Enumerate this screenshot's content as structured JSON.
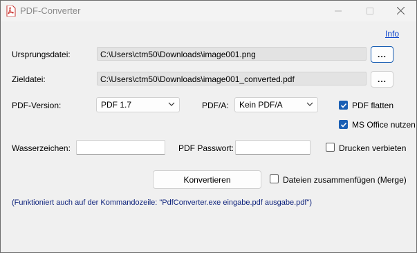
{
  "window": {
    "title": "PDF-Converter"
  },
  "links": {
    "info": "Info"
  },
  "source": {
    "label": "Ursprungsdatei:",
    "value": "C:\\Users\\ctm50\\Downloads\\image001.png",
    "browse": "..."
  },
  "target": {
    "label": "Zieldatei:",
    "value": "C:\\Users\\ctm50\\Downloads\\image001_converted.pdf",
    "browse": "..."
  },
  "pdf_version": {
    "label": "PDF-Version:",
    "selected": "PDF 1.7"
  },
  "pdfa": {
    "label": "PDF/A:",
    "selected": "Kein PDF/A"
  },
  "options": {
    "flatten": {
      "label": "PDF flatten",
      "checked": true
    },
    "ms_office": {
      "label": "MS Office nutzen",
      "checked": true
    },
    "print_forbid": {
      "label": "Drucken verbieten",
      "checked": false
    },
    "merge": {
      "label": "Dateien zusammenfügen (Merge)",
      "checked": false
    }
  },
  "watermark": {
    "label": "Wasserzeichen:",
    "value": ""
  },
  "password": {
    "label": "PDF Passwort:",
    "value": ""
  },
  "convert_button": "Konvertieren",
  "footer_note": "(Funktioniert auch auf der Kommandozeile: \"PdfConverter.exe eingabe.pdf ausgabe.pdf\")",
  "colors": {
    "accent": "#1a5fb4",
    "link": "#0c44cc",
    "note": "#0a1f7a",
    "background": "#f0f0f0"
  },
  "icons": {
    "app": "pdf-file-icon",
    "minimize": "minimize-icon",
    "maximize": "maximize-icon",
    "close": "close-icon",
    "dropdown": "chevron-down-icon",
    "check": "checkmark-icon"
  }
}
